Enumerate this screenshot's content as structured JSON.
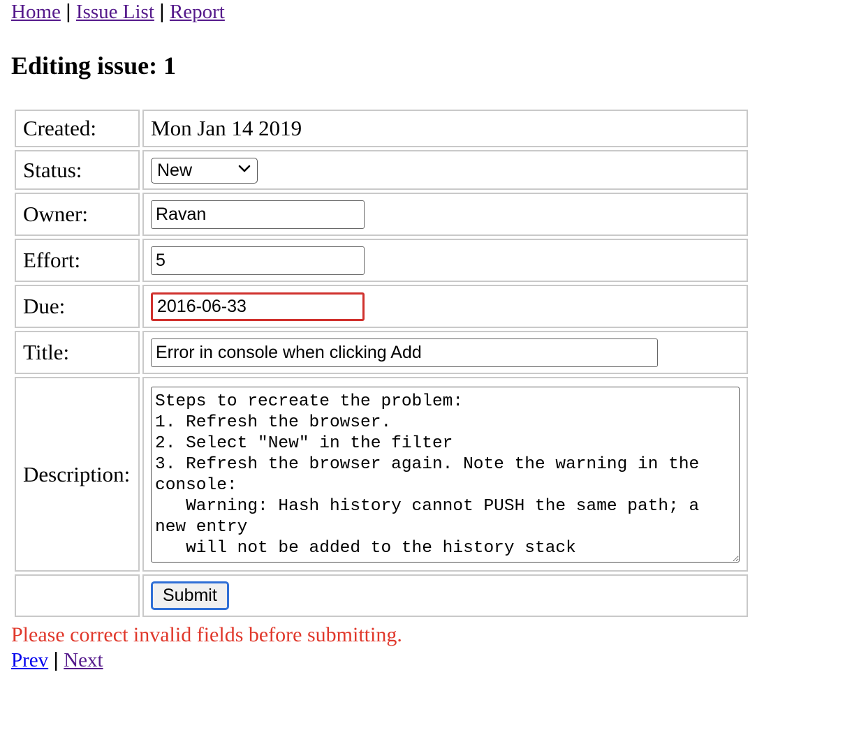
{
  "nav": {
    "home": "Home",
    "issue_list": "Issue List",
    "report": "Report",
    "separator": "|"
  },
  "page": {
    "title": "Editing issue: 1"
  },
  "form": {
    "created": {
      "label": "Created:",
      "value": "Mon Jan 14 2019"
    },
    "status": {
      "label": "Status:",
      "value": "New"
    },
    "owner": {
      "label": "Owner:",
      "value": "Ravan"
    },
    "effort": {
      "label": "Effort:",
      "value": "5"
    },
    "due": {
      "label": "Due:",
      "value": "2016-06-33"
    },
    "title": {
      "label": "Title:",
      "value": "Error in console when clicking Add"
    },
    "description": {
      "label": "Description:",
      "value": "Steps to recreate the problem:\n1. Refresh the browser.\n2. Select \"New\" in the filter\n3. Refresh the browser again. Note the warning in the console:\n   Warning: Hash history cannot PUSH the same path; a new entry\n   will not be added to the history stack"
    },
    "submit_label": "Submit"
  },
  "validation": {
    "message": "Please correct invalid fields before submitting."
  },
  "pager": {
    "prev": "Prev",
    "next": "Next",
    "separator": "|"
  },
  "colors": {
    "link_visited": "#551a8b",
    "link_unvisited": "#0000ee",
    "error_text": "#e0382b",
    "invalid_border": "#d0312d",
    "focus_border": "#2f6fd6",
    "table_border": "#c9c9c9"
  }
}
